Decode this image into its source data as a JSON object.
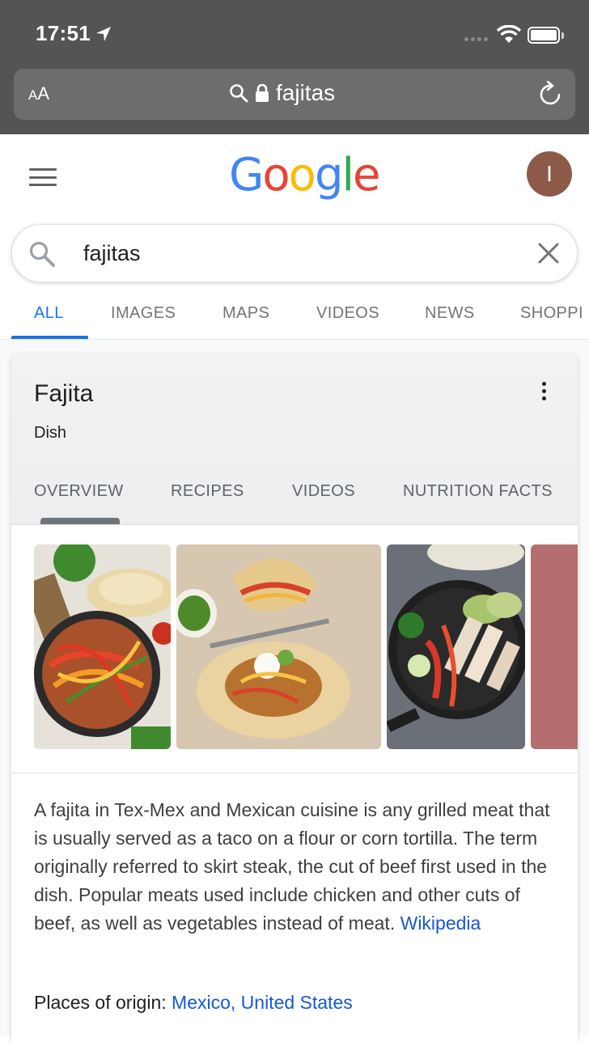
{
  "status_bar": {
    "time": "17:51"
  },
  "safari": {
    "text_size_label_small": "A",
    "text_size_label_large": "A",
    "url_text": "fajitas",
    "icons": [
      "location-arrow-icon",
      "wifi-icon",
      "battery-icon",
      "magnifier-icon",
      "lock-icon",
      "reload-icon"
    ]
  },
  "google": {
    "logo": [
      {
        "ch": "G",
        "color": "#4285F4"
      },
      {
        "ch": "o",
        "color": "#EA4335"
      },
      {
        "ch": "o",
        "color": "#FBBC05"
      },
      {
        "ch": "g",
        "color": "#4285F4"
      },
      {
        "ch": "l",
        "color": "#34A853"
      },
      {
        "ch": "e",
        "color": "#EA4335"
      }
    ],
    "avatar_initial": "I",
    "avatar_color": "#8d5a4a"
  },
  "search": {
    "query": "fajitas"
  },
  "tabs": [
    "ALL",
    "IMAGES",
    "MAPS",
    "VIDEOS",
    "NEWS",
    "SHOPPI"
  ],
  "active_tab": "ALL",
  "accent": "#1a73e8",
  "knowledge_panel": {
    "title": "Fajita",
    "subtitle": "Dish",
    "tabs": [
      "OVERVIEW",
      "RECIPES",
      "VIDEOS",
      "NUTRITION FACTS"
    ],
    "active_tab": "OVERVIEW",
    "images": [
      "fajitas-skillet-photo",
      "fajita-tacos-photo",
      "chicken-fajita-skillet-photo",
      "fajitas-partial-photo"
    ],
    "description": "A fajita in Tex-Mex and Mexican cuisine is any grilled meat that is usually served as a taco on a flour or corn tortilla. The term originally referred to skirt steak, the cut of beef first used in the dish. Popular meats used include chicken and other cuts of beef, as well as vegetables instead of meat.",
    "source_link": "Wikipedia",
    "origin_label": "Places of origin:",
    "origin_values": "Mexico, United States"
  }
}
